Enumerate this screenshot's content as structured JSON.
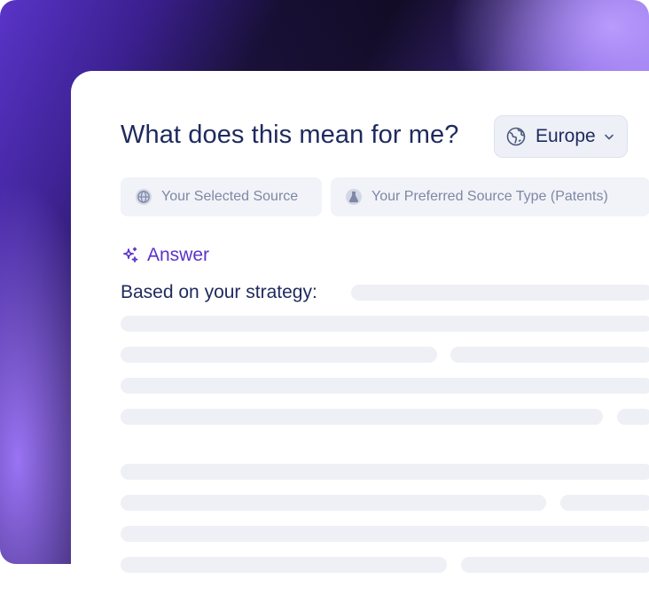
{
  "header": {
    "question": "What does this mean for me?",
    "region": {
      "selected": "Europe",
      "icon": "globe-icon",
      "dropdown_icon": "chevron-down-icon"
    }
  },
  "sources": [
    {
      "label": "Your Selected Source",
      "icon": "globe-icon"
    },
    {
      "label": "Your Preferred Source Type (Patents)",
      "icon": "flask-icon"
    }
  ],
  "answer": {
    "label": "Answer",
    "icon": "sparkle-icon",
    "intro": "Based on your strategy:"
  },
  "colors": {
    "title": "#1e2a5e",
    "accent": "#5a34c9",
    "chip_bg": "#f1f3f8",
    "skeleton": "#eef0f6"
  }
}
